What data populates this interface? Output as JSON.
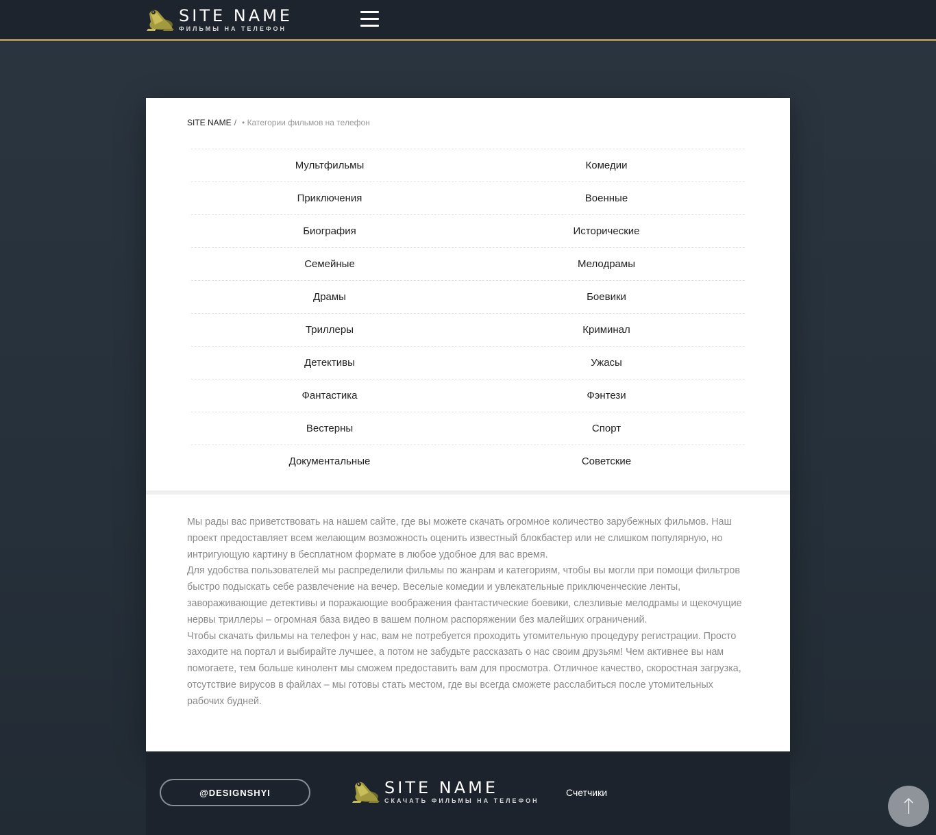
{
  "header": {
    "logo_title": "SITE NAME",
    "logo_subtitle": "ФИЛЬМЫ НА ТЕЛЕФОН",
    "menu_icon": "hamburger-icon"
  },
  "breadcrumb": {
    "home": "SITE NAME",
    "separator": "/",
    "current": "• Категории фильмов на телефон"
  },
  "categories": [
    [
      "Мультфильмы",
      "Комедии"
    ],
    [
      "Приключения",
      "Военные"
    ],
    [
      "Биография",
      "Исторические"
    ],
    [
      "Семейные",
      "Мелодрамы"
    ],
    [
      "Драмы",
      "Боевики"
    ],
    [
      "Триллеры",
      "Криминал"
    ],
    [
      "Детективы",
      "Ужасы"
    ],
    [
      "Фантастика",
      "Фэнтези"
    ],
    [
      "Вестерны",
      "Спорт"
    ],
    [
      "Документальные",
      "Советские"
    ]
  ],
  "description": [
    "Мы рады вас приветствовать на нашем сайте, где вы можете скачать огромное количество зарубежных фильмов. Наш проект предоставляет всем желающим возможность оценить известный блокбастер или не слишком популярную, но интригующую картину в бесплатном формате в любое удобное для вас время.",
    "Для удобства пользователей мы распределили фильмы по жанрам и категориям, чтобы вы могли при помощи фильтров быстро подыскать себе развлечение на вечер. Веселые комедии и увлекательные приключенческие ленты, завораживающие детективы и поражающие воображения фантастические боевики, слезливые мелодрамы и щекочущие нервы триллеры – огромная база видео в вашем полном распоряжении без малейших ограничений.",
    "Чтобы скачать фильмы на телефон у нас, вам не потребуется проходить утомительную процедуру регистрации. Просто заходите на портал и выбирайте лучшее, а потом не забудьте рассказать о нас своим друзьям! Чем активнее вы нам помогаете, тем больше кинолент мы сможем предоставить вам для просмотра. Отличное качество, скоростная загрузка, отсутствие вирусов в файлах – мы готовы стать местом, где вы всегда сможете расслабиться после утомительных рабочих будней."
  ],
  "footer": {
    "designer_label": "@DESIGNSHYI",
    "logo_title": "SITE NAME",
    "logo_subtitle": "СКАЧАТЬ ФИЛЬМЫ НА ТЕЛЕФОН",
    "counters_label": "Счетчики"
  },
  "scroll_top_icon": "arrow-up-icon",
  "colors": {
    "accent_gold": "#a8925a",
    "header_bg": "#1d242d",
    "page_bg": "#2b3540"
  }
}
